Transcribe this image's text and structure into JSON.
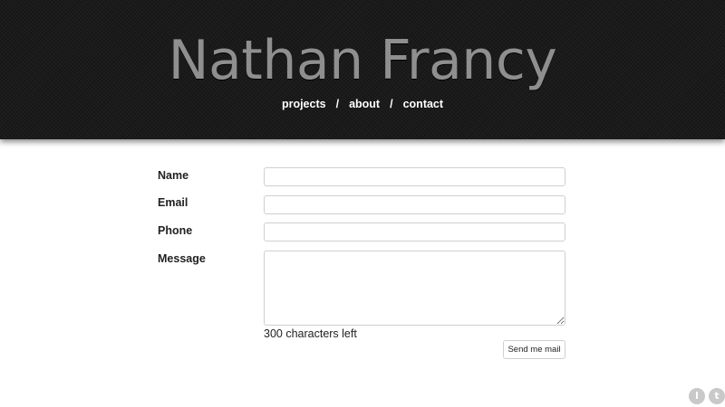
{
  "header": {
    "title": "Nathan Francy",
    "nav": [
      {
        "label": "projects"
      },
      {
        "label": "about"
      },
      {
        "label": "contact"
      }
    ],
    "separator": "/"
  },
  "form": {
    "fields": {
      "name": {
        "label": "Name",
        "value": ""
      },
      "email": {
        "label": "Email",
        "value": ""
      },
      "phone": {
        "label": "Phone",
        "value": ""
      },
      "message": {
        "label": "Message",
        "value": ""
      }
    },
    "chars_left": "300 characters left",
    "submit_label": "Send me mail"
  },
  "social": [
    {
      "icon": "linkedin-icon",
      "glyph": "l"
    },
    {
      "icon": "twitter-icon",
      "glyph": "t"
    }
  ],
  "colors": {
    "header_bg": "#1b1b1b",
    "title": "#8f8f8f",
    "nav_text": "#ffffff",
    "social_bg": "#c9c9c9"
  }
}
